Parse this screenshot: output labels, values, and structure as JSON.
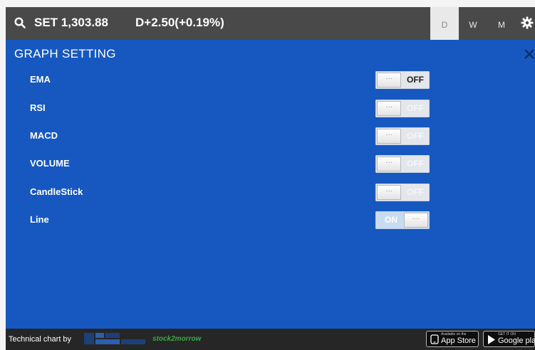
{
  "header": {
    "index_label": "SET 1,303.88",
    "change_label": "D+2.50(+0.19%)",
    "periods": [
      "D",
      "W",
      "M"
    ],
    "active_period": "D"
  },
  "panel": {
    "title": "GRAPH SETTING",
    "settings": [
      {
        "label": "EMA",
        "state": "OFF",
        "knob": "···"
      },
      {
        "label": "RSI",
        "state": "OFF",
        "knob": "···"
      },
      {
        "label": "MACD",
        "state": "OFF",
        "knob": "···"
      },
      {
        "label": "VOLUME",
        "state": "OFF",
        "knob": "···"
      },
      {
        "label": "CandleStick",
        "state": "OFF",
        "knob": "···"
      },
      {
        "label": "Line",
        "state": "ON",
        "knob": "···"
      }
    ]
  },
  "footer": {
    "credit": "Technical chart by",
    "partner_b": "stock2morrow",
    "app_store_small": "Available on the",
    "app_store_big": "App Store",
    "google_play_small": "GET IT ON",
    "google_play_big": "Google play"
  },
  "colors": {
    "panel_bg": "#1658c0",
    "header_bg": "#4a4949",
    "footer_bg": "#262626"
  },
  "icons": [
    "search-icon",
    "gear-icon",
    "close-icon",
    "apple-icon",
    "google-play-icon"
  ]
}
